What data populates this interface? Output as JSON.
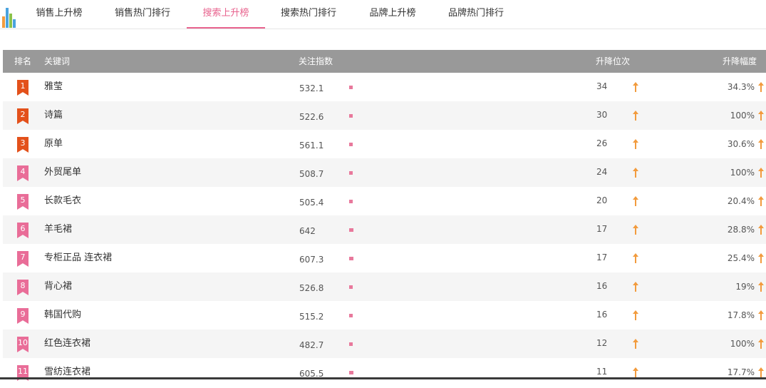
{
  "colors": {
    "accent": "#e8638e",
    "top_badge": "#e3511b",
    "badge": "#e96d98",
    "arrow": "#f29b3d",
    "header_bg": "#999999"
  },
  "logo_icon": "bar-chart-icon",
  "tabs": [
    {
      "label": "销售上升榜",
      "active": false
    },
    {
      "label": "销售热门排行",
      "active": false
    },
    {
      "label": "搜索上升榜",
      "active": true
    },
    {
      "label": "搜索热门排行",
      "active": false
    },
    {
      "label": "品牌上升榜",
      "active": false
    },
    {
      "label": "品牌热门排行",
      "active": false
    }
  ],
  "table": {
    "headers": {
      "rank": "排名",
      "keyword": "关键词",
      "index": "关注指数",
      "rank_change": "升降位次",
      "change_pct": "升降幅度"
    },
    "rows": [
      {
        "rank": "1",
        "keyword": "雅莹",
        "index": "532.1",
        "rank_change": "34",
        "change_pct": "34.3%"
      },
      {
        "rank": "2",
        "keyword": "诗篇",
        "index": "522.6",
        "rank_change": "30",
        "change_pct": "100%"
      },
      {
        "rank": "3",
        "keyword": "原单",
        "index": "561.1",
        "rank_change": "26",
        "change_pct": "30.6%"
      },
      {
        "rank": "4",
        "keyword": "外贸尾单",
        "index": "508.7",
        "rank_change": "24",
        "change_pct": "100%"
      },
      {
        "rank": "5",
        "keyword": "长款毛衣",
        "index": "505.4",
        "rank_change": "20",
        "change_pct": "20.4%"
      },
      {
        "rank": "6",
        "keyword": "羊毛裙",
        "index": "642",
        "rank_change": "17",
        "change_pct": "28.8%"
      },
      {
        "rank": "7",
        "keyword": "专柜正品 连衣裙",
        "index": "607.3",
        "rank_change": "17",
        "change_pct": "25.4%"
      },
      {
        "rank": "8",
        "keyword": "背心裙",
        "index": "526.8",
        "rank_change": "16",
        "change_pct": "19%"
      },
      {
        "rank": "9",
        "keyword": "韩国代购",
        "index": "515.2",
        "rank_change": "16",
        "change_pct": "17.8%"
      },
      {
        "rank": "10",
        "keyword": "红色连衣裙",
        "index": "482.7",
        "rank_change": "12",
        "change_pct": "100%"
      },
      {
        "rank": "11",
        "keyword": "雪纺连衣裙",
        "index": "605.5",
        "rank_change": "11",
        "change_pct": "17.7%"
      }
    ]
  }
}
